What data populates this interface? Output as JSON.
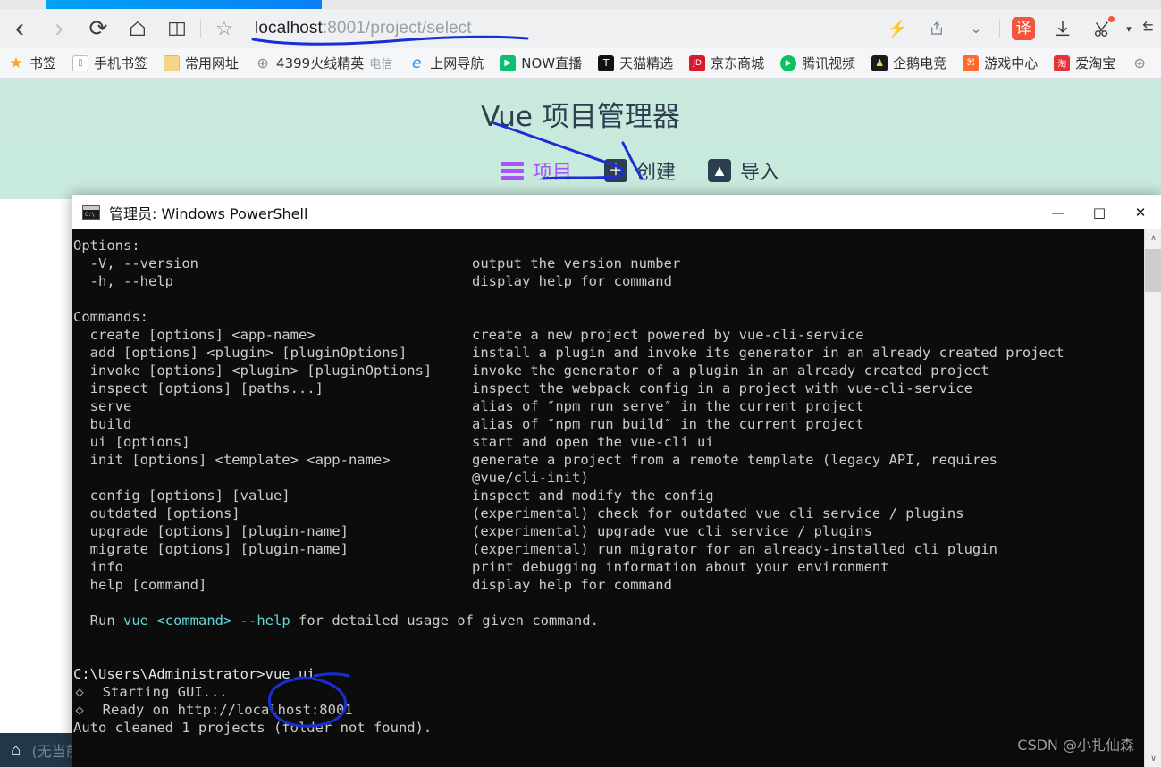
{
  "browser": {
    "nav_icons": [
      {
        "name": "back-icon",
        "glyph": "‹",
        "dim": false
      },
      {
        "name": "forward-icon",
        "glyph": "›",
        "dim": true
      },
      {
        "name": "reload-icon",
        "glyph": "↻",
        "dim": false
      },
      {
        "name": "home-icon",
        "glyph": "⌂",
        "dim": false
      },
      {
        "name": "reading-list-icon",
        "glyph": "◫",
        "dim": false
      }
    ],
    "star_icon": "☆",
    "url": {
      "host": "localhost",
      "rest": ":8001/project/select",
      "full": "localhost:8001/project/select"
    },
    "right_icons": [
      {
        "name": "lightning-icon",
        "glyph": "⚡"
      },
      {
        "name": "share-icon",
        "glyph": "⎙"
      },
      {
        "name": "chevron-down-icon",
        "glyph": "∨"
      }
    ],
    "translate_badge": "译",
    "download_icon": "⤓",
    "screenshot_icon": "✂",
    "screenshot_caret": "▾",
    "pin_icon": "⤅"
  },
  "bookmarks": [
    {
      "label": "书签",
      "icon": "star-icon",
      "glyph": "★",
      "bg": "transparent",
      "fg": "#f5a623"
    },
    {
      "label": "手机书签",
      "icon": "phone-icon",
      "glyph": "⎕",
      "bg": "#ffffff",
      "fg": "#7a7a7a"
    },
    {
      "label": "常用网址",
      "icon": "folder-icon",
      "glyph": "▭",
      "bg": "#f6d58a",
      "fg": "#f6d58a"
    },
    {
      "label": "4399火线精英",
      "sub": "电信",
      "icon": "globe-icon",
      "glyph": "⊕",
      "bg": "transparent",
      "fg": "#8b8b8b"
    },
    {
      "label": "上网导航",
      "icon": "edge-icon",
      "glyph": "e",
      "bg": "transparent",
      "fg": "#1a8cff"
    },
    {
      "label": "NOW直播",
      "icon": "now-live-icon",
      "glyph": "▶",
      "bg": "#0ac070",
      "fg": "#ffffff"
    },
    {
      "label": "天猫精选",
      "icon": "tmall-icon",
      "glyph": "T",
      "bg": "#000000",
      "fg": "#ffffff"
    },
    {
      "label": "京东商城",
      "icon": "jd-icon",
      "glyph": "JD",
      "bg": "#d9182b",
      "fg": "#ffffff"
    },
    {
      "label": "腾讯视频",
      "icon": "tencent-video-icon",
      "glyph": "▶",
      "bg": "#0fbf61",
      "fg": "#ffffff"
    },
    {
      "label": "企鹅电竞",
      "icon": "penguin-esports-icon",
      "glyph": "♟",
      "bg": "#1b1b1b",
      "fg": "#ffd24a"
    },
    {
      "label": "游戏中心",
      "icon": "gamepad-icon",
      "glyph": "Ἲe",
      "bg": "#ff6a2b",
      "fg": "#ffffff"
    },
    {
      "label": "爱淘宝",
      "icon": "taobao-icon",
      "glyph": "淘",
      "bg": "#e53238",
      "fg": "#ffffff"
    },
    {
      "label": "",
      "icon": "globe-icon",
      "glyph": "⊕",
      "bg": "transparent",
      "fg": "#8b8b8b"
    }
  ],
  "vue_page": {
    "title": "Vue 项目管理器",
    "nav": [
      {
        "name": "projects",
        "label": "项目",
        "icon": "list-bars-icon",
        "active": true
      },
      {
        "name": "create",
        "label": "创建",
        "icon": "plus-icon",
        "active": false
      },
      {
        "name": "import",
        "label": "导入",
        "icon": "import-icon",
        "active": false
      }
    ],
    "status_bar": {
      "home_icon": "home-icon",
      "text": "(无当前"
    },
    "accent": "#a855f7",
    "background": "#c9ebdd"
  },
  "powershell": {
    "title": "管理员: Windows PowerShell",
    "controls": {
      "minimize": "—",
      "maximize": "□",
      "close": "✕"
    },
    "scrollbar": {
      "up": "∧",
      "down": "∨"
    },
    "console_lines": [
      {
        "t": "plain",
        "left": "Options:",
        "right": ""
      },
      {
        "t": "plain",
        "left": "  -V, --version",
        "right": "output the version number"
      },
      {
        "t": "plain",
        "left": "  -h, --help",
        "right": "display help for command"
      },
      {
        "t": "blank",
        "left": "",
        "right": ""
      },
      {
        "t": "plain",
        "left": "Commands:",
        "right": ""
      },
      {
        "t": "plain",
        "left": "  create [options] <app-name>",
        "right": "create a new project powered by vue-cli-service"
      },
      {
        "t": "plain",
        "left": "  add [options] <plugin> [pluginOptions]",
        "right": "install a plugin and invoke its generator in an already created project"
      },
      {
        "t": "plain",
        "left": "  invoke [options] <plugin> [pluginOptions]",
        "right": "invoke the generator of a plugin in an already created project"
      },
      {
        "t": "plain",
        "left": "  inspect [options] [paths...]",
        "right": "inspect the webpack config in a project with vue-cli-service"
      },
      {
        "t": "plain",
        "left": "  serve",
        "right": "alias of ″npm run serve″ in the current project"
      },
      {
        "t": "plain",
        "left": "  build",
        "right": "alias of ″npm run build″ in the current project"
      },
      {
        "t": "plain",
        "left": "  ui [options]",
        "right": "start and open the vue-cli ui"
      },
      {
        "t": "plain",
        "left": "  init [options] <template> <app-name>",
        "right": "generate a project from a remote template (legacy API, requires"
      },
      {
        "t": "plain",
        "left": "",
        "right": "@vue/cli-init)"
      },
      {
        "t": "plain",
        "left": "  config [options] [value]",
        "right": "inspect and modify the config"
      },
      {
        "t": "plain",
        "left": "  outdated [options]",
        "right": "(experimental) check for outdated vue cli service / plugins"
      },
      {
        "t": "plain",
        "left": "  upgrade [options] [plugin-name]",
        "right": "(experimental) upgrade vue cli service / plugins"
      },
      {
        "t": "plain",
        "left": "  migrate [options] [plugin-name]",
        "right": "(experimental) run migrator for an already-installed cli plugin"
      },
      {
        "t": "plain",
        "left": "  info",
        "right": "print debugging information about your environment"
      },
      {
        "t": "plain",
        "left": "  help [command]",
        "right": "display help for command"
      },
      {
        "t": "blank",
        "left": "",
        "right": ""
      }
    ],
    "run_hint": {
      "prefix": "  Run ",
      "cmd_vue": "vue",
      "cmd_arg": " <command> ",
      "cmd_help": "--help",
      "suffix": " for detailed usage of given command."
    },
    "prompt_line": {
      "path": "C:\\Users\\Administrator>",
      "command": "vue ui"
    },
    "output_lines": [
      {
        "marker": "◇",
        "text": "  Starting GUI..."
      },
      {
        "marker": "◇",
        "text": "  Ready on http://localhost:8001"
      }
    ],
    "final_line": "Auto cleaned 1 projects (folder not found)."
  },
  "watermark": "CSDN @小扎仙森",
  "annotations": {
    "ink_color": "#1a2ed6",
    "marks": [
      {
        "name": "url-underline-annotation"
      },
      {
        "name": "create-button-arrow-annotation"
      },
      {
        "name": "vue-ui-command-circle-annotation"
      }
    ]
  }
}
